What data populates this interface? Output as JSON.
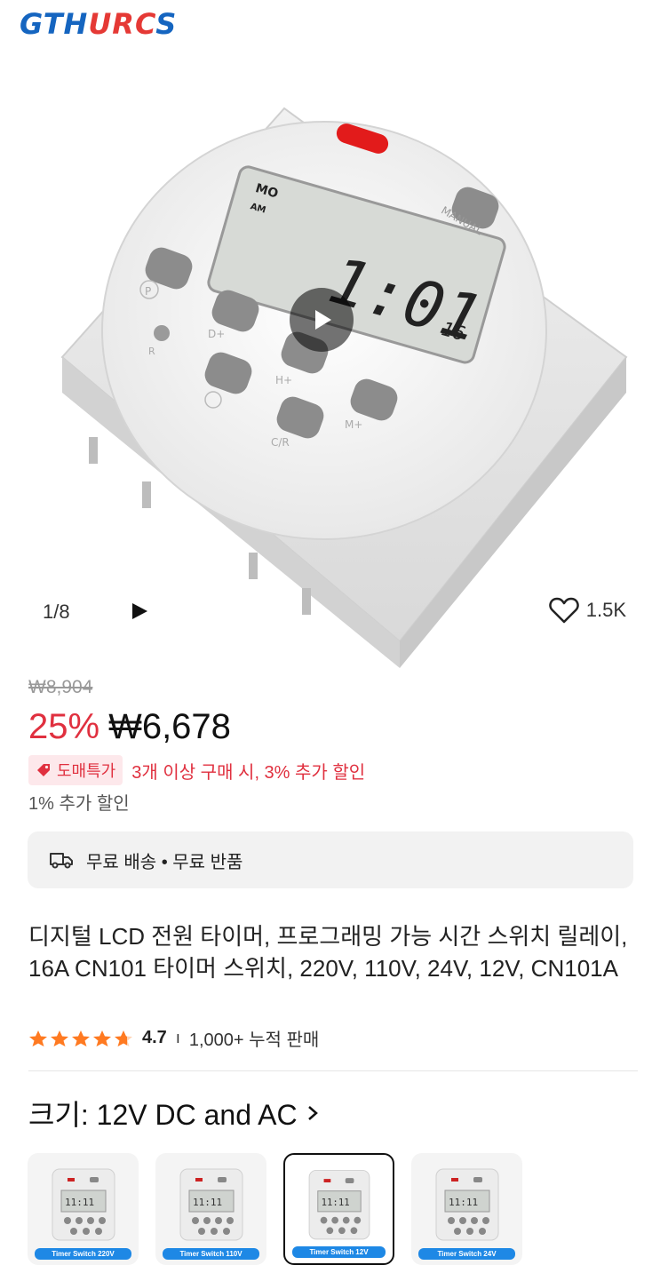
{
  "brand": {
    "prefix": "GTH",
    "accent": "URC",
    "suffix": "S"
  },
  "gallery": {
    "counter": "1/8",
    "likes": "1.5K"
  },
  "pricing": {
    "original": "₩8,904",
    "discount": "25%",
    "price": "₩6,678",
    "promo_badge": "도매특가",
    "promo_text": "3개 이상 구매 시, 3% 추가 할인",
    "extra_discount": "1% 추가 할인"
  },
  "shipping": {
    "label": "무료 배송 • 무료 반품"
  },
  "product": {
    "title": "디지털 LCD 전원 타이머, 프로그래밍 가능 시간 스위치 릴레이, 16A CN101 타이머 스위치, 220V, 110V, 24V, 12V, CN101A",
    "rating": "4.7",
    "sold": "1,000+ 누적 판매"
  },
  "size": {
    "label": "크기: 12V DC and AC"
  },
  "variants": [
    {
      "caption": "Timer Switch 220V"
    },
    {
      "caption": "Timer Switch 110V"
    },
    {
      "caption": "Timer Switch 12V"
    },
    {
      "caption": "Timer Switch 24V"
    }
  ],
  "lcd": {
    "day": "MO",
    "ampm": "AM",
    "time": "1:01",
    "seconds": "16"
  },
  "device_labels": {
    "manual": "MANUAL",
    "p": "P",
    "d": "D+",
    "r": "R",
    "h": "H+",
    "cr": "C/R",
    "m": "M+"
  },
  "colors": {
    "accent_red": "#e0303f",
    "brand_blue": "#1565c0",
    "star": "#ff7a21",
    "variant_blue": "#1e88e5"
  }
}
